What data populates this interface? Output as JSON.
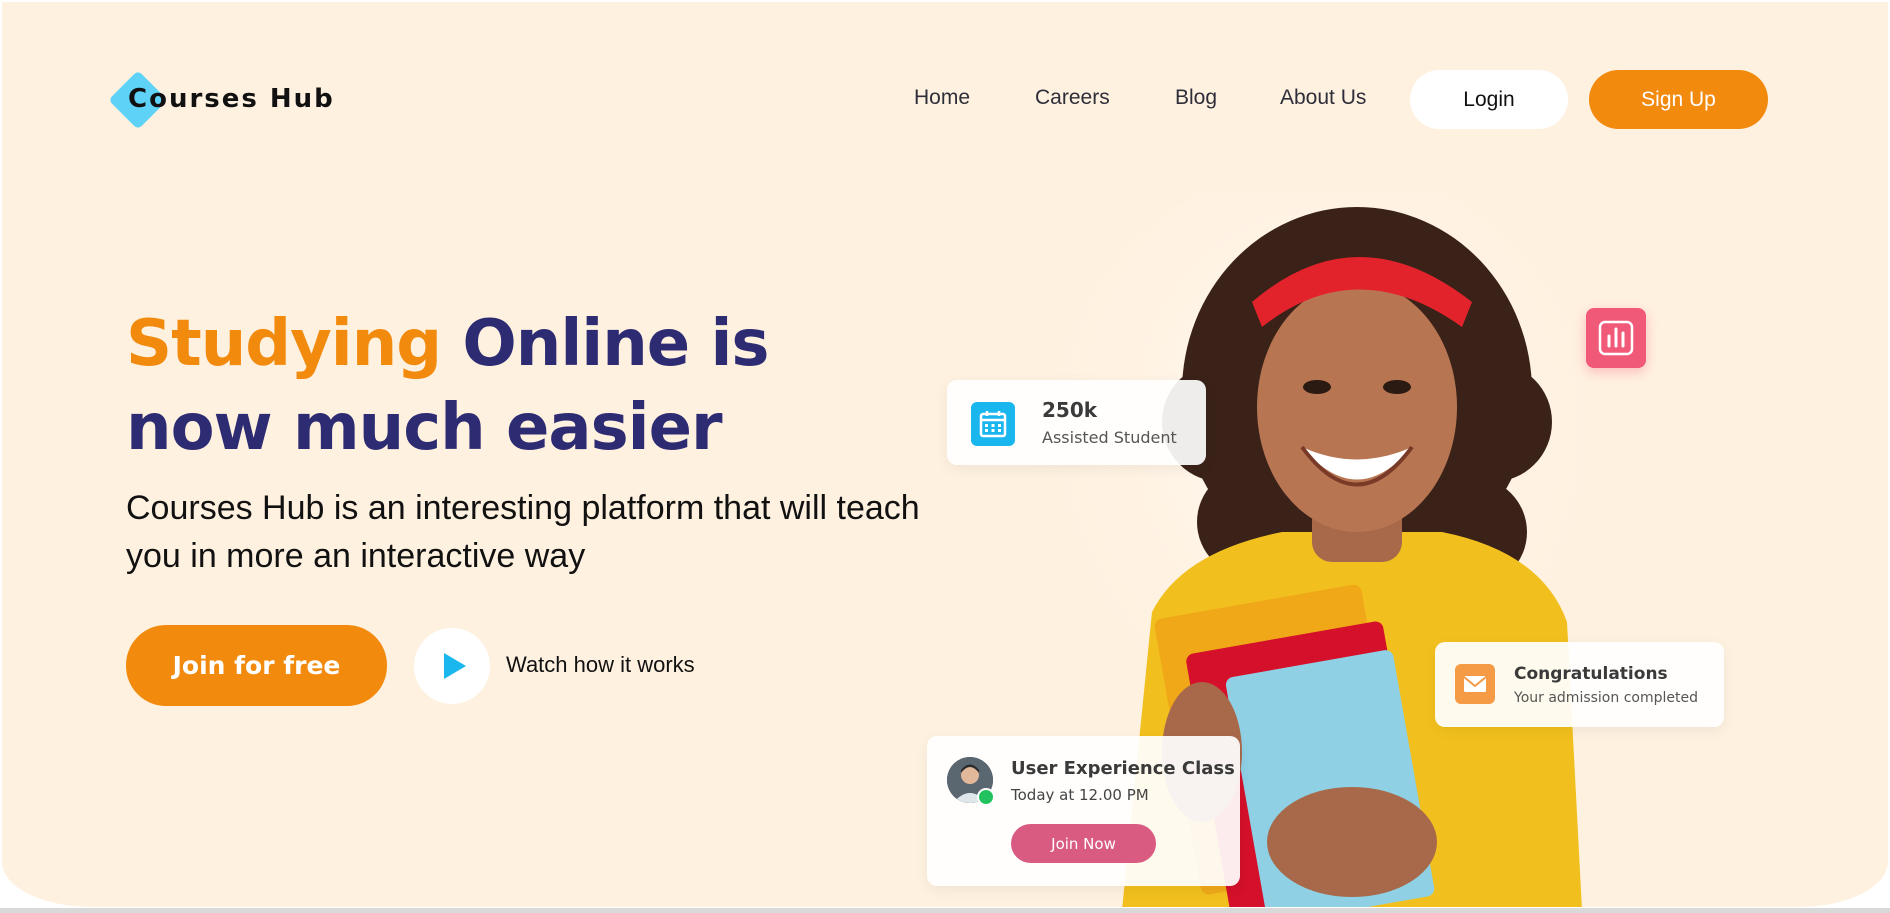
{
  "brand": {
    "name": "Courses Hub",
    "accent_color": "#5fd3f7"
  },
  "nav": {
    "links": [
      "Home",
      "Careers",
      "Blog",
      "About Us"
    ],
    "login_label": "Login",
    "signup_label": "Sign Up"
  },
  "hero": {
    "headline_accent": "Studying",
    "headline_rest": " Online is now much easier",
    "subtext": "Courses Hub is an interesting platform that will teach you in more an interactive way",
    "join_label": "Join for free",
    "watch_label": "Watch how it works"
  },
  "cards": {
    "students": {
      "value": "250k",
      "label": "Assisted Student",
      "icon": "calendar-icon"
    },
    "stats_icon": "bar-chart-icon",
    "congrats": {
      "title": "Congratulations",
      "desc": "Your admission completed",
      "icon": "mail-icon"
    },
    "class": {
      "title": "User Experience Class",
      "time": "Today at 12.00 PM",
      "button_label": "Join Now"
    }
  },
  "colors": {
    "background": "#fff1e0",
    "primary_orange": "#f28a0e",
    "headline_navy": "#2d2c73",
    "calendar_blue": "#1ab6ee",
    "chart_pink": "#f05a78",
    "join_now_pink": "#d95b82",
    "online_green": "#22c35e"
  }
}
